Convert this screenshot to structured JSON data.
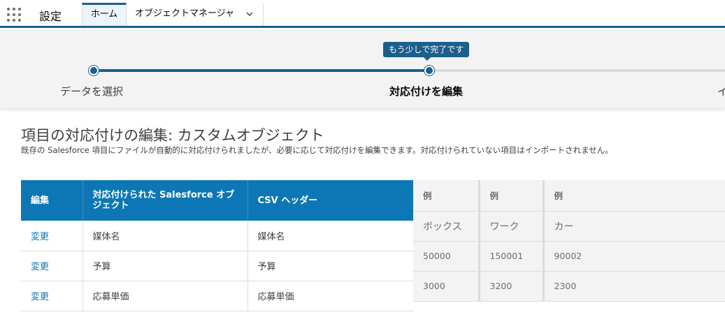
{
  "nav": {
    "app_name": "設定",
    "tabs": [
      {
        "label": "ホーム"
      },
      {
        "label": "オブジェクトマネージャ"
      }
    ]
  },
  "progress": {
    "tooltip": "もう少しで完了です",
    "steps": [
      {
        "label": "データを選択"
      },
      {
        "label": "対応付けを編集"
      },
      {
        "label": "イ"
      }
    ],
    "fraction_complete": 0.53
  },
  "page": {
    "title": "項目の対応付けの編集: カスタムオブジェクト",
    "description": "既存の Salesforce 項目にファイルが自動的に対応付けられましたが、必要に応じて対応付けを編集できます。対応付けられていない項目はインポートされません。"
  },
  "mapping_table": {
    "headers": [
      "編集",
      "対応付けられた Salesforce オブジェクト",
      "CSV ヘッダー"
    ],
    "rows": [
      {
        "edit": "変更",
        "field": "媒体名",
        "csv": "媒体名"
      },
      {
        "edit": "変更",
        "field": "予算",
        "csv": "予算"
      },
      {
        "edit": "変更",
        "field": "応募単価",
        "csv": "応募単価"
      }
    ]
  },
  "example_table": {
    "headers": [
      "例",
      "例",
      "例"
    ],
    "rows": [
      [
        "ボックス",
        "ワーク",
        "カー"
      ],
      [
        "50000",
        "150001",
        "90002"
      ],
      [
        "3000",
        "3200",
        "2300"
      ]
    ]
  },
  "colors": {
    "brand": "#1b5f8a",
    "header_blue": "#0d77b5",
    "link": "#0d77b5"
  }
}
